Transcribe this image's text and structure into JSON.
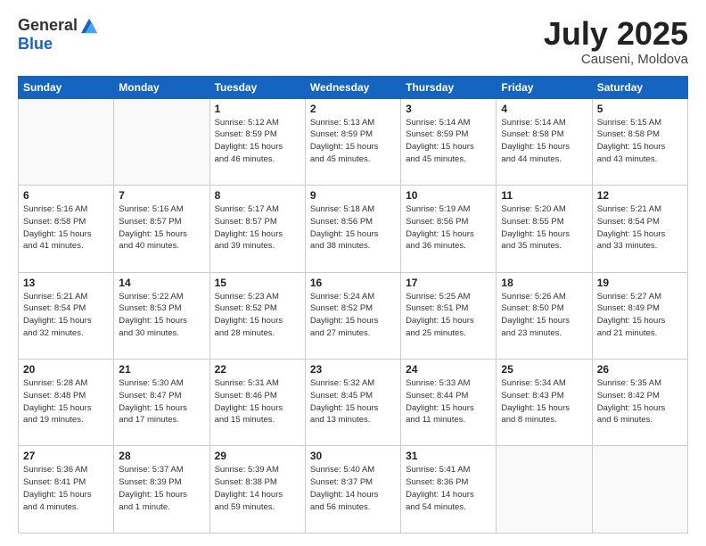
{
  "logo": {
    "general": "General",
    "blue": "Blue"
  },
  "title": "July 2025",
  "location": "Causeni, Moldova",
  "days_of_week": [
    "Sunday",
    "Monday",
    "Tuesday",
    "Wednesday",
    "Thursday",
    "Friday",
    "Saturday"
  ],
  "weeks": [
    [
      {
        "day": "",
        "info": ""
      },
      {
        "day": "",
        "info": ""
      },
      {
        "day": "1",
        "info": "Sunrise: 5:12 AM\nSunset: 8:59 PM\nDaylight: 15 hours\nand 46 minutes."
      },
      {
        "day": "2",
        "info": "Sunrise: 5:13 AM\nSunset: 8:59 PM\nDaylight: 15 hours\nand 45 minutes."
      },
      {
        "day": "3",
        "info": "Sunrise: 5:14 AM\nSunset: 8:59 PM\nDaylight: 15 hours\nand 45 minutes."
      },
      {
        "day": "4",
        "info": "Sunrise: 5:14 AM\nSunset: 8:58 PM\nDaylight: 15 hours\nand 44 minutes."
      },
      {
        "day": "5",
        "info": "Sunrise: 5:15 AM\nSunset: 8:58 PM\nDaylight: 15 hours\nand 43 minutes."
      }
    ],
    [
      {
        "day": "6",
        "info": "Sunrise: 5:16 AM\nSunset: 8:58 PM\nDaylight: 15 hours\nand 41 minutes."
      },
      {
        "day": "7",
        "info": "Sunrise: 5:16 AM\nSunset: 8:57 PM\nDaylight: 15 hours\nand 40 minutes."
      },
      {
        "day": "8",
        "info": "Sunrise: 5:17 AM\nSunset: 8:57 PM\nDaylight: 15 hours\nand 39 minutes."
      },
      {
        "day": "9",
        "info": "Sunrise: 5:18 AM\nSunset: 8:56 PM\nDaylight: 15 hours\nand 38 minutes."
      },
      {
        "day": "10",
        "info": "Sunrise: 5:19 AM\nSunset: 8:56 PM\nDaylight: 15 hours\nand 36 minutes."
      },
      {
        "day": "11",
        "info": "Sunrise: 5:20 AM\nSunset: 8:55 PM\nDaylight: 15 hours\nand 35 minutes."
      },
      {
        "day": "12",
        "info": "Sunrise: 5:21 AM\nSunset: 8:54 PM\nDaylight: 15 hours\nand 33 minutes."
      }
    ],
    [
      {
        "day": "13",
        "info": "Sunrise: 5:21 AM\nSunset: 8:54 PM\nDaylight: 15 hours\nand 32 minutes."
      },
      {
        "day": "14",
        "info": "Sunrise: 5:22 AM\nSunset: 8:53 PM\nDaylight: 15 hours\nand 30 minutes."
      },
      {
        "day": "15",
        "info": "Sunrise: 5:23 AM\nSunset: 8:52 PM\nDaylight: 15 hours\nand 28 minutes."
      },
      {
        "day": "16",
        "info": "Sunrise: 5:24 AM\nSunset: 8:52 PM\nDaylight: 15 hours\nand 27 minutes."
      },
      {
        "day": "17",
        "info": "Sunrise: 5:25 AM\nSunset: 8:51 PM\nDaylight: 15 hours\nand 25 minutes."
      },
      {
        "day": "18",
        "info": "Sunrise: 5:26 AM\nSunset: 8:50 PM\nDaylight: 15 hours\nand 23 minutes."
      },
      {
        "day": "19",
        "info": "Sunrise: 5:27 AM\nSunset: 8:49 PM\nDaylight: 15 hours\nand 21 minutes."
      }
    ],
    [
      {
        "day": "20",
        "info": "Sunrise: 5:28 AM\nSunset: 8:48 PM\nDaylight: 15 hours\nand 19 minutes."
      },
      {
        "day": "21",
        "info": "Sunrise: 5:30 AM\nSunset: 8:47 PM\nDaylight: 15 hours\nand 17 minutes."
      },
      {
        "day": "22",
        "info": "Sunrise: 5:31 AM\nSunset: 8:46 PM\nDaylight: 15 hours\nand 15 minutes."
      },
      {
        "day": "23",
        "info": "Sunrise: 5:32 AM\nSunset: 8:45 PM\nDaylight: 15 hours\nand 13 minutes."
      },
      {
        "day": "24",
        "info": "Sunrise: 5:33 AM\nSunset: 8:44 PM\nDaylight: 15 hours\nand 11 minutes."
      },
      {
        "day": "25",
        "info": "Sunrise: 5:34 AM\nSunset: 8:43 PM\nDaylight: 15 hours\nand 8 minutes."
      },
      {
        "day": "26",
        "info": "Sunrise: 5:35 AM\nSunset: 8:42 PM\nDaylight: 15 hours\nand 6 minutes."
      }
    ],
    [
      {
        "day": "27",
        "info": "Sunrise: 5:36 AM\nSunset: 8:41 PM\nDaylight: 15 hours\nand 4 minutes."
      },
      {
        "day": "28",
        "info": "Sunrise: 5:37 AM\nSunset: 8:39 PM\nDaylight: 15 hours\nand 1 minute."
      },
      {
        "day": "29",
        "info": "Sunrise: 5:39 AM\nSunset: 8:38 PM\nDaylight: 14 hours\nand 59 minutes."
      },
      {
        "day": "30",
        "info": "Sunrise: 5:40 AM\nSunset: 8:37 PM\nDaylight: 14 hours\nand 56 minutes."
      },
      {
        "day": "31",
        "info": "Sunrise: 5:41 AM\nSunset: 8:36 PM\nDaylight: 14 hours\nand 54 minutes."
      },
      {
        "day": "",
        "info": ""
      },
      {
        "day": "",
        "info": ""
      }
    ]
  ]
}
